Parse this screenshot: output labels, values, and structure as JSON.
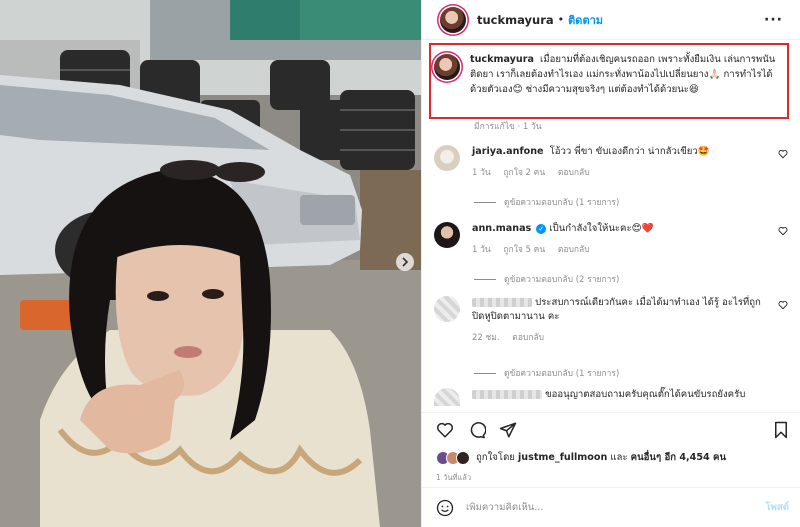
{
  "header": {
    "username": "tuckmayura",
    "dot": "•",
    "follow_label": "ติดตาม",
    "more_label": "···"
  },
  "caption": {
    "username": "tuckmayura",
    "text": "เมื่อยามที่ต้องเชิญคนรถออก เพราะทั้งยืมเงิน เล่นการพนัน ติดยา เราก็เลยต้องทำไรเอง แม่กระทั่งพาน้องไปเปลี่ยนยาง🙏🏻 การทำไรได้ด้วยตัวเอง😊 ช่างมีความสุขจริงๆ แต่ต้องทำได้ด้วยนะ😆",
    "edited": "มีการแก้ไข · 1 วัน"
  },
  "comments": [
    {
      "username": "jariya.anfone",
      "text": "โอ้วว พี่ขา ขับเองดีกว่า น่ากลัวเขียว🤩",
      "time": "1 วัน",
      "likes": "ถูกใจ 2 คน",
      "reply": "ตอบกลับ",
      "replies": "ดูข้อความตอบกลับ (1 รายการ)"
    },
    {
      "username": "ann.manas",
      "text": "เป็นกำลังใจให้นะคะ😍❤️",
      "time": "1 วัน",
      "likes": "ถูกใจ 5 คน",
      "reply": "ตอบกลับ",
      "replies": "ดูข้อความตอบกลับ (2 รายการ)"
    },
    {
      "text": "ประสบการณ์เดียวกันคะ เมื่อได้มาทำเอง ได้รู้ อะไรที่ถูกปิดหูปิดตามานาน คะ",
      "time": "22 ชม.",
      "reply": "ตอบกลับ",
      "replies": "ดูข้อความตอบกลับ (1 รายการ)"
    },
    {
      "text": "ขออนุญาตสอบถามครับคุณตั๊กได้คนขับรถยังครับ"
    }
  ],
  "likes": {
    "prefix": "ถูกใจโดย",
    "user": "justme_fullmoon",
    "middle": "และ",
    "others": "คนอื่นๆ อีก 4,454 คน"
  },
  "time_ago": "1 วันที่แล้ว",
  "add_comment": {
    "placeholder": "เพิ่มความคิดเห็น...",
    "post_label": "โพสต์"
  },
  "icons": {
    "like": "heart-icon",
    "comment": "comment-icon",
    "share": "send-icon",
    "save": "bookmark-icon",
    "emoji": "smile-icon",
    "more": "more-icon",
    "next": "chevron-right-icon"
  },
  "colors": {
    "follow": "#0095f6",
    "highlight_box": "#e0292d",
    "post_disabled": "#b2dffc"
  }
}
